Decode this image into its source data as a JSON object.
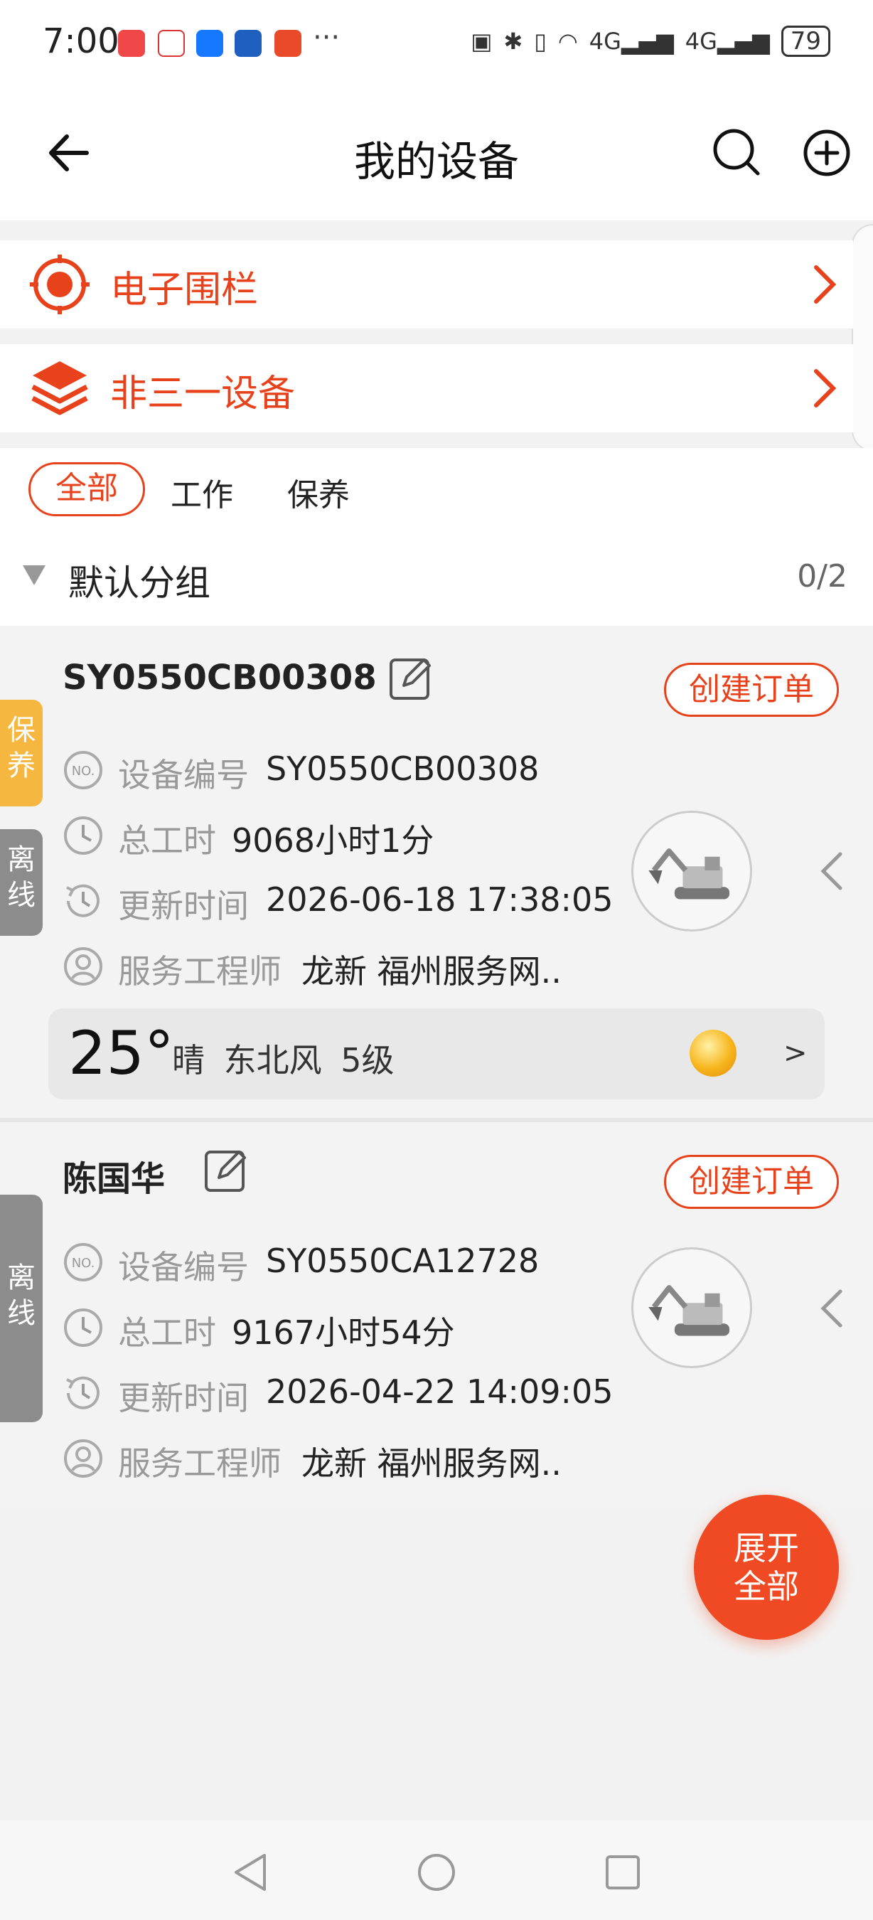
{
  "status_bar": {
    "time": "7:00",
    "overflow": "···",
    "network": "4G",
    "network2": "4G",
    "battery": "79"
  },
  "header": {
    "title": "我的设备"
  },
  "features": [
    {
      "label": "电子围栏",
      "icon": "target-icon"
    },
    {
      "label": "非三一设备",
      "icon": "layers-icon"
    }
  ],
  "filters": {
    "tabs": [
      "全部",
      "工作",
      "保养"
    ],
    "active": "全部"
  },
  "group": {
    "name": "默认分组",
    "count": "0/2"
  },
  "devices": [
    {
      "title": "SY0550CB00308",
      "order_button": "创建订单",
      "tags": [
        "保养",
        "离线"
      ],
      "fields": [
        {
          "label": "设备编号",
          "value": "SY0550CB00308",
          "icon": "number-icon"
        },
        {
          "label": "总工时",
          "value": "9068小时1分",
          "icon": "hours-icon"
        },
        {
          "label": "更新时间",
          "value": "2026-06-18 17:38:05",
          "icon": "clock-icon"
        },
        {
          "label": "服务工程师",
          "value": "龙新 福州服务网..",
          "icon": "person-icon"
        }
      ],
      "weather": {
        "temperature": "25°",
        "description": "晴  东北风  5级",
        "arrow": ">"
      }
    },
    {
      "title": "陈国华",
      "order_button": "创建订单",
      "tags": [
        "离线"
      ],
      "fields": [
        {
          "label": "设备编号",
          "value": "SY0550CA12728",
          "icon": "number-icon"
        },
        {
          "label": "总工时",
          "value": "9167小时54分",
          "icon": "hours-icon"
        },
        {
          "label": "更新时间",
          "value": "2026-04-22 14:09:05",
          "icon": "clock-icon"
        },
        {
          "label": "服务工程师",
          "value": "龙新 福州服务网..",
          "icon": "person-icon"
        }
      ]
    }
  ],
  "fab": {
    "line1": "展开",
    "line2": "全部"
  },
  "colors": {
    "accent": "#e8421c",
    "tag_maintenance": "#f5b740",
    "tag_offline": "#8c8c8c"
  }
}
